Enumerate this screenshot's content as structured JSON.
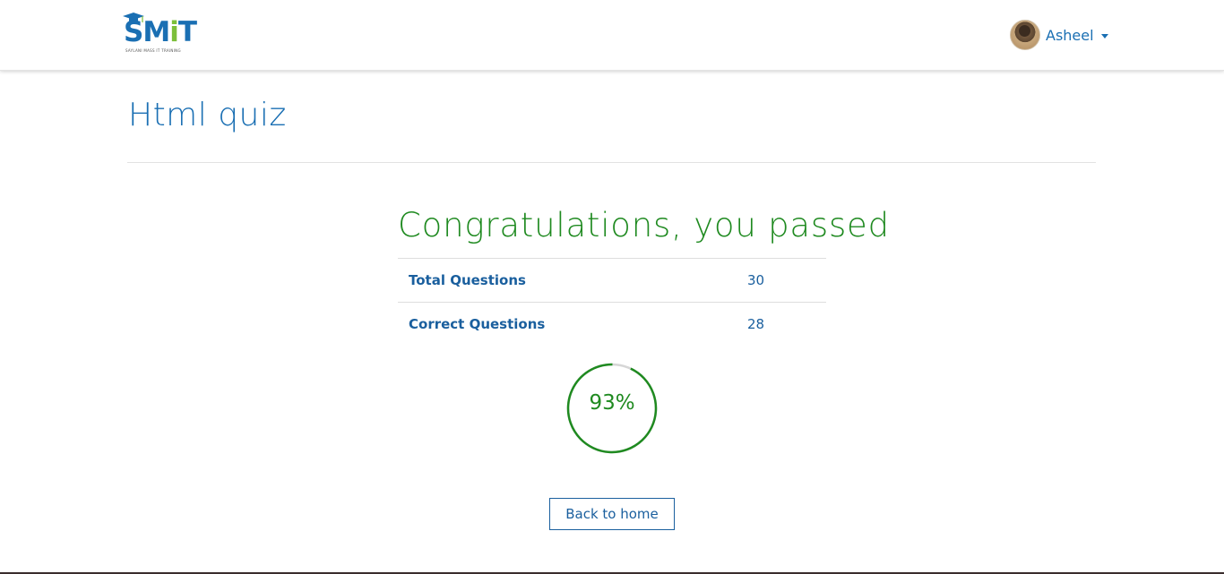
{
  "header": {
    "logo_text_prefix": "SM",
    "logo_text_i": "i",
    "logo_text_suffix": "T",
    "logo_subtitle": "SAYLANI MASS IT TRAINING",
    "user_name": "Asheel"
  },
  "quiz": {
    "title": "Html quiz",
    "result_heading": "Congratulations, you passed",
    "stats": [
      {
        "label": "Total Questions",
        "value": "30"
      },
      {
        "label": "Correct Questions",
        "value": "28"
      }
    ],
    "score_percent_text": "93%",
    "score_fraction": 0.93,
    "back_button_label": "Back to home"
  },
  "colors": {
    "brand_blue": "#1a6fb3",
    "success_green": "#1f8a20",
    "logo_green": "#7cbf3a"
  },
  "icons": {
    "logo": "graduation-cap-logo",
    "user_menu": "chevron-down-icon"
  }
}
